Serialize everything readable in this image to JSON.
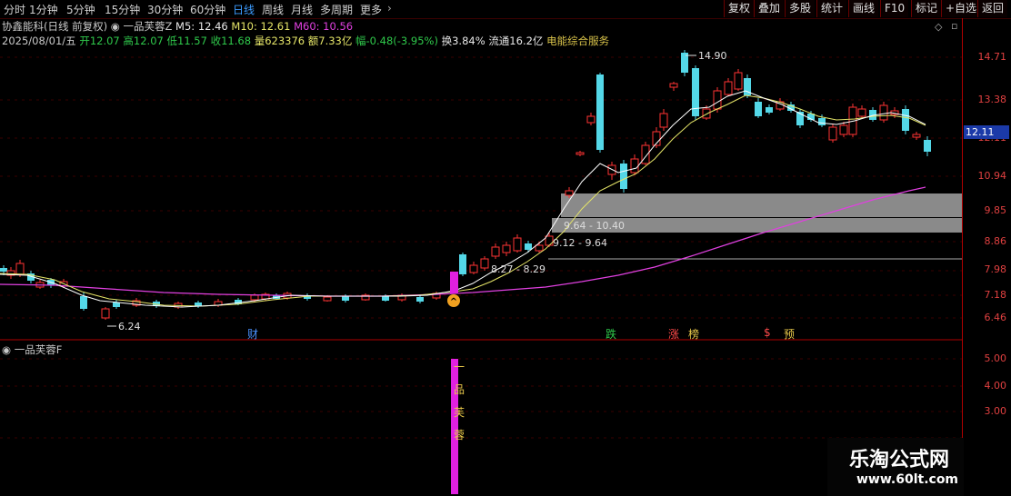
{
  "toolbar": {
    "periods": [
      "分时",
      "1分钟",
      "5分钟",
      "15分钟",
      "30分钟",
      "60分钟",
      "日线",
      "周线",
      "月线",
      "多周期",
      "更多"
    ],
    "active_period": "日线",
    "buttons": [
      "复权",
      "叠加",
      "多股",
      "统计",
      "画线",
      "F10",
      "标记",
      "+自选",
      "返回"
    ]
  },
  "header": {
    "stock_name": "协鑫能科",
    "view_mode": "(日线 前复权)",
    "indicator_name": "一品芙蓉Z",
    "ma5_label": "M5: 12.46",
    "ma10_label": "M10: 12.61",
    "ma60_label": "M60: 10.56",
    "date": "2025/08/01/五",
    "open_label": "开12.07",
    "high_label": "高12.07",
    "low_label": "低11.57",
    "close_label": "收11.68",
    "volume_label": "量623376",
    "amount_label": "额7.33亿",
    "change_label": "幅-0.48(-3.95%)",
    "turnover_label": "换3.84%",
    "float_label": "流通16.2亿",
    "sector": "电能综合服务"
  },
  "price_axis": [
    "14.71",
    "13.38",
    "12.11",
    "10.94",
    "9.85",
    "8.86",
    "7.98",
    "7.18",
    "6.46"
  ],
  "current_price": "12.11",
  "annotations": {
    "high_marker": "14.90",
    "low_marker": "6.24",
    "zone1": "9.64 - 10.40",
    "zone2": "9.12 - 9.64",
    "zone3": "8.27 - 8.29"
  },
  "events": [
    {
      "label": "财",
      "color": "#4a90ff"
    },
    {
      "label": "跌",
      "color": "#2fc94b"
    },
    {
      "label": "涨",
      "color": "#ff4a4a"
    },
    {
      "label": "榜",
      "color": "#e8c84a"
    },
    {
      "label": "$",
      "color": "#ff4a4a"
    },
    {
      "label": "预",
      "color": "#e8c84a"
    }
  ],
  "sub_panel": {
    "title": "一品芙蓉F",
    "axis": [
      "5.00",
      "4.00",
      "3.00"
    ],
    "vertical_label": [
      "一",
      "品",
      "芙",
      "蓉"
    ]
  },
  "watermark": {
    "title": "乐淘公式网",
    "url": "www.60lt.com"
  },
  "colors": {
    "up": "#ff3333",
    "down": "#54d8e8",
    "ma5": "#ffffff",
    "ma10": "#e5e568",
    "ma60": "#e040e0",
    "axis": "#e04040",
    "signal": "#e020e0"
  }
}
